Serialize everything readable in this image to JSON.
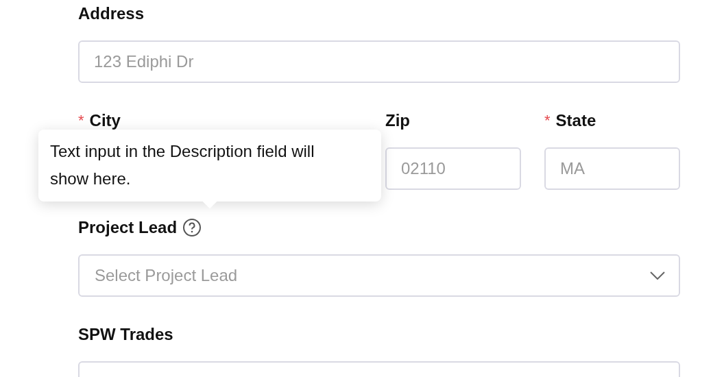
{
  "address": {
    "label": "Address",
    "placeholder": "123 Ediphi Dr"
  },
  "location_row": [
    {
      "label": "City",
      "required_mark": "*"
    },
    {
      "label": "Zip",
      "placeholder": "02110"
    },
    {
      "label": "State",
      "required_mark": "*",
      "placeholder": "MA"
    }
  ],
  "project_lead": {
    "label": "Project Lead",
    "placeholder": "Select Project Lead"
  },
  "spw_trades": {
    "label": "SPW Trades"
  },
  "tooltip": {
    "text": "Text input in the Description field will show here."
  }
}
